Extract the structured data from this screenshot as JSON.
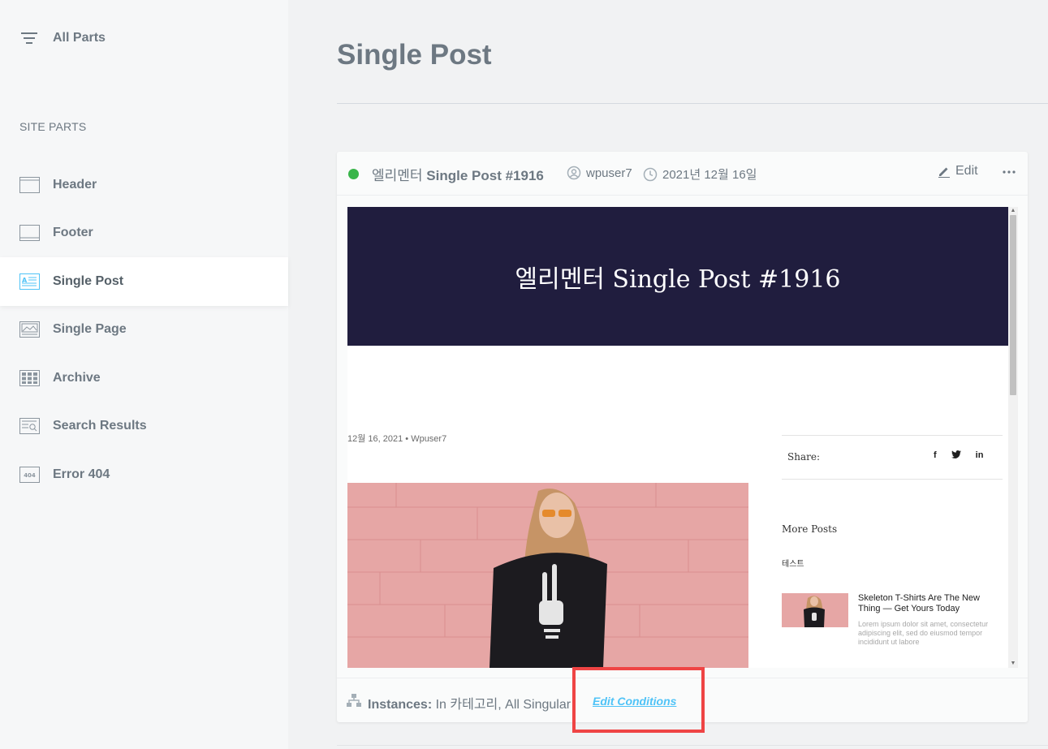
{
  "sidebar": {
    "all_parts_label": "All Parts",
    "section_title": "SITE PARTS",
    "items": [
      {
        "label": "Header",
        "icon": "header-icon"
      },
      {
        "label": "Footer",
        "icon": "footer-icon"
      },
      {
        "label": "Single Post",
        "icon": "single-post-icon",
        "active": true
      },
      {
        "label": "Single Page",
        "icon": "single-page-icon"
      },
      {
        "label": "Archive",
        "icon": "archive-icon"
      },
      {
        "label": "Search Results",
        "icon": "search-results-icon"
      },
      {
        "label": "Error 404",
        "icon": "error-404-icon",
        "icon_text": "404"
      }
    ]
  },
  "page": {
    "title": "Single Post"
  },
  "card": {
    "status_color": "#39b54a",
    "title_prefix": "엘리멘터",
    "title_rest": "Single Post #1916",
    "author": "wpuser7",
    "date": "2021년 12월 16일",
    "edit_label": "Edit",
    "more_label": "···"
  },
  "preview": {
    "hero_title": "엘리멘터 Single Post #1916",
    "hero_color": "#201d3e",
    "post_meta": "12월 16, 2021  •  Wpuser7",
    "share_label": "Share:",
    "share_icons": [
      "f",
      "t",
      "in"
    ],
    "more_posts_label": "More Posts",
    "category_label": "테스트",
    "more_post_title": "Skeleton T-Shirts Are The New Thing — Get Yours Today",
    "more_post_excerpt": "Lorem ipsum dolor sit amet, consectetur adipiscing elit, sed do eiusmod tempor incididunt ut labore"
  },
  "footer": {
    "instances_label": "Instances:",
    "instances_value": "In 카테고리, All Singular",
    "edit_conditions_label": "Edit Conditions",
    "link_color": "#4fc3f7",
    "highlight_color": "#ef4444"
  }
}
